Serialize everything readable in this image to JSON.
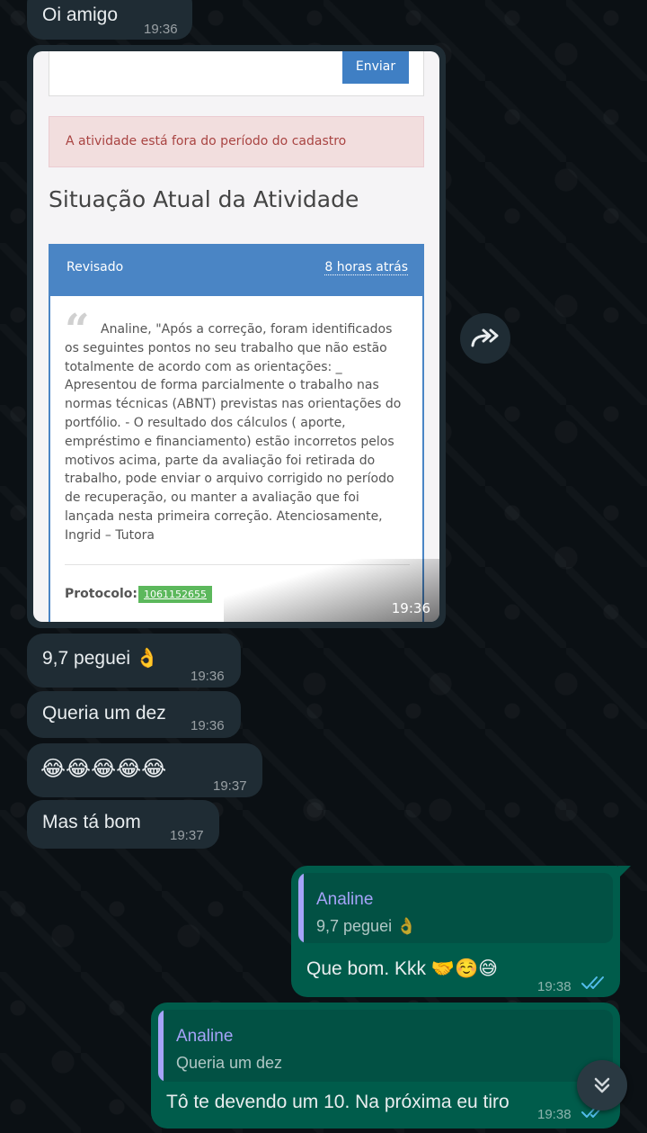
{
  "messages": {
    "m0": {
      "text": "Oi amigo",
      "time": "19:36"
    },
    "image": {
      "time": "19:36",
      "send_button": "Enviar",
      "alert": "A atividade está fora do período do cadastro",
      "section_title": "Situação Atual da Atividade",
      "panel_status": "Revisado",
      "panel_age": "8 horas atrás",
      "quote": "Analine, \"Após a correção, foram identificados os seguintes pontos no seu trabalho que não estão totalmente de acordo com as orientações: _ Apresentou de forma parcialmente o trabalho nas normas técnicas (ABNT) previstas nas orientações do portfólio. - O resultado dos cálculos ( aporte, empréstimo e financiamento) estão incorretos pelos motivos acima, parte da avaliação foi retirada do trabalho, pode enviar o arquivo corrigido no período de recuperação, ou manter a avaliação que foi lançada nesta primeira correção. Atenciosamente, Ingrid – Tutora",
      "protocol_label": "Protocolo:",
      "protocol_number": "1061152655"
    },
    "m1": {
      "text": "9,7 peguei 👌",
      "time": "19:36"
    },
    "m2": {
      "text": "Queria um dez",
      "time": "19:36"
    },
    "m3": {
      "text": "😂😂😂😂😂",
      "time": "19:37"
    },
    "m4": {
      "text": "Mas tá bom",
      "time": "19:37"
    },
    "m5": {
      "reply_name": "Analine",
      "reply_text": "9,7 peguei 👌",
      "text": "Que bom. Kkk 🤝☺️😅",
      "time": "19:38"
    },
    "m6": {
      "reply_name": "Analine",
      "reply_text": "Queria um dez",
      "text": "Tô te devendo um 10. Na próxima eu tiro",
      "time": "19:38"
    }
  },
  "icons": {
    "forward": "forward-icon",
    "quote": "quote-icon",
    "read_ticks": "double-check-icon",
    "scroll_down": "chevron-double-down-icon"
  },
  "colors": {
    "incoming_bubble": "#1f2c34",
    "outgoing_bubble": "#005c4b",
    "read_tick": "#53bdeb",
    "reply_name": "#a5a3f8"
  }
}
